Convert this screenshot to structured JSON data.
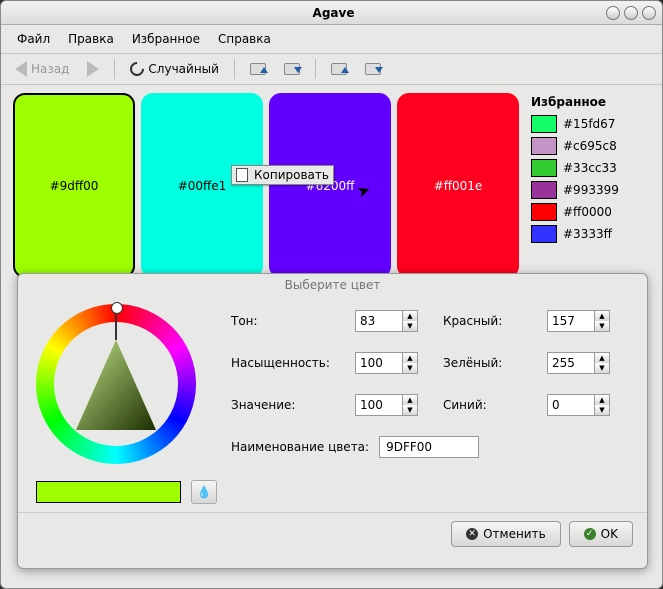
{
  "app": {
    "title": "Agave"
  },
  "menubar": [
    "Файл",
    "Правка",
    "Избранное",
    "Справка"
  ],
  "toolbar": {
    "back": "Назад",
    "random": "Случайный"
  },
  "swatches": [
    {
      "hex": "#9dff00",
      "selected": true,
      "textColor": "#000"
    },
    {
      "hex": "#00ffe1",
      "selected": false,
      "textColor": "#000"
    },
    {
      "hex": "#6200ff",
      "selected": false,
      "textColor": "#fff"
    },
    {
      "hex": "#ff001e",
      "selected": false,
      "textColor": "#fff"
    }
  ],
  "context_menu": {
    "copy": "Копировать"
  },
  "sidebar": {
    "title": "Избранное",
    "items": [
      {
        "hex": "#15fd67"
      },
      {
        "hex": "#c695c8"
      },
      {
        "hex": "#33cc33"
      },
      {
        "hex": "#993399"
      },
      {
        "hex": "#ff0000"
      },
      {
        "hex": "#3333ff"
      }
    ]
  },
  "dialog": {
    "title": "Выберите цвет",
    "labels": {
      "hue": "Тон:",
      "sat": "Насыщенность:",
      "val": "Значение:",
      "red": "Красный:",
      "green": "Зелёный:",
      "blue": "Синий:",
      "name": "Наименование цвета:"
    },
    "values": {
      "hue": "83",
      "sat": "100",
      "val": "100",
      "red": "157",
      "green": "255",
      "blue": "0",
      "name": "9DFF00"
    },
    "preview_color": "#9dff00",
    "buttons": {
      "cancel": "Отменить",
      "ok": "OK"
    }
  }
}
